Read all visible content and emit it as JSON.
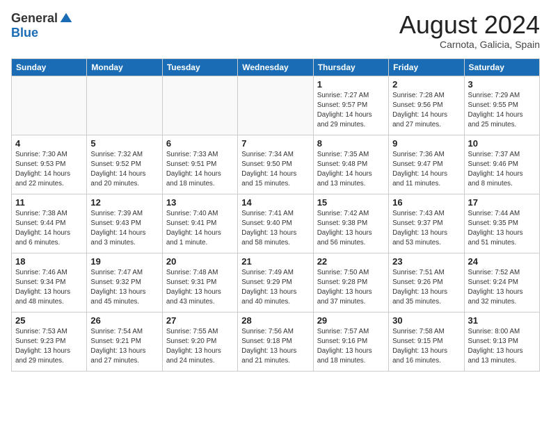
{
  "header": {
    "logo_general": "General",
    "logo_blue": "Blue",
    "month_year": "August 2024",
    "location": "Carnota, Galicia, Spain"
  },
  "days_of_week": [
    "Sunday",
    "Monday",
    "Tuesday",
    "Wednesday",
    "Thursday",
    "Friday",
    "Saturday"
  ],
  "weeks": [
    [
      {
        "day": "",
        "info": ""
      },
      {
        "day": "",
        "info": ""
      },
      {
        "day": "",
        "info": ""
      },
      {
        "day": "",
        "info": ""
      },
      {
        "day": "1",
        "info": "Sunrise: 7:27 AM\nSunset: 9:57 PM\nDaylight: 14 hours and 29 minutes."
      },
      {
        "day": "2",
        "info": "Sunrise: 7:28 AM\nSunset: 9:56 PM\nDaylight: 14 hours and 27 minutes."
      },
      {
        "day": "3",
        "info": "Sunrise: 7:29 AM\nSunset: 9:55 PM\nDaylight: 14 hours and 25 minutes."
      }
    ],
    [
      {
        "day": "4",
        "info": "Sunrise: 7:30 AM\nSunset: 9:53 PM\nDaylight: 14 hours and 22 minutes."
      },
      {
        "day": "5",
        "info": "Sunrise: 7:32 AM\nSunset: 9:52 PM\nDaylight: 14 hours and 20 minutes."
      },
      {
        "day": "6",
        "info": "Sunrise: 7:33 AM\nSunset: 9:51 PM\nDaylight: 14 hours and 18 minutes."
      },
      {
        "day": "7",
        "info": "Sunrise: 7:34 AM\nSunset: 9:50 PM\nDaylight: 14 hours and 15 minutes."
      },
      {
        "day": "8",
        "info": "Sunrise: 7:35 AM\nSunset: 9:48 PM\nDaylight: 14 hours and 13 minutes."
      },
      {
        "day": "9",
        "info": "Sunrise: 7:36 AM\nSunset: 9:47 PM\nDaylight: 14 hours and 11 minutes."
      },
      {
        "day": "10",
        "info": "Sunrise: 7:37 AM\nSunset: 9:46 PM\nDaylight: 14 hours and 8 minutes."
      }
    ],
    [
      {
        "day": "11",
        "info": "Sunrise: 7:38 AM\nSunset: 9:44 PM\nDaylight: 14 hours and 6 minutes."
      },
      {
        "day": "12",
        "info": "Sunrise: 7:39 AM\nSunset: 9:43 PM\nDaylight: 14 hours and 3 minutes."
      },
      {
        "day": "13",
        "info": "Sunrise: 7:40 AM\nSunset: 9:41 PM\nDaylight: 14 hours and 1 minute."
      },
      {
        "day": "14",
        "info": "Sunrise: 7:41 AM\nSunset: 9:40 PM\nDaylight: 13 hours and 58 minutes."
      },
      {
        "day": "15",
        "info": "Sunrise: 7:42 AM\nSunset: 9:38 PM\nDaylight: 13 hours and 56 minutes."
      },
      {
        "day": "16",
        "info": "Sunrise: 7:43 AM\nSunset: 9:37 PM\nDaylight: 13 hours and 53 minutes."
      },
      {
        "day": "17",
        "info": "Sunrise: 7:44 AM\nSunset: 9:35 PM\nDaylight: 13 hours and 51 minutes."
      }
    ],
    [
      {
        "day": "18",
        "info": "Sunrise: 7:46 AM\nSunset: 9:34 PM\nDaylight: 13 hours and 48 minutes."
      },
      {
        "day": "19",
        "info": "Sunrise: 7:47 AM\nSunset: 9:32 PM\nDaylight: 13 hours and 45 minutes."
      },
      {
        "day": "20",
        "info": "Sunrise: 7:48 AM\nSunset: 9:31 PM\nDaylight: 13 hours and 43 minutes."
      },
      {
        "day": "21",
        "info": "Sunrise: 7:49 AM\nSunset: 9:29 PM\nDaylight: 13 hours and 40 minutes."
      },
      {
        "day": "22",
        "info": "Sunrise: 7:50 AM\nSunset: 9:28 PM\nDaylight: 13 hours and 37 minutes."
      },
      {
        "day": "23",
        "info": "Sunrise: 7:51 AM\nSunset: 9:26 PM\nDaylight: 13 hours and 35 minutes."
      },
      {
        "day": "24",
        "info": "Sunrise: 7:52 AM\nSunset: 9:24 PM\nDaylight: 13 hours and 32 minutes."
      }
    ],
    [
      {
        "day": "25",
        "info": "Sunrise: 7:53 AM\nSunset: 9:23 PM\nDaylight: 13 hours and 29 minutes."
      },
      {
        "day": "26",
        "info": "Sunrise: 7:54 AM\nSunset: 9:21 PM\nDaylight: 13 hours and 27 minutes."
      },
      {
        "day": "27",
        "info": "Sunrise: 7:55 AM\nSunset: 9:20 PM\nDaylight: 13 hours and 24 minutes."
      },
      {
        "day": "28",
        "info": "Sunrise: 7:56 AM\nSunset: 9:18 PM\nDaylight: 13 hours and 21 minutes."
      },
      {
        "day": "29",
        "info": "Sunrise: 7:57 AM\nSunset: 9:16 PM\nDaylight: 13 hours and 18 minutes."
      },
      {
        "day": "30",
        "info": "Sunrise: 7:58 AM\nSunset: 9:15 PM\nDaylight: 13 hours and 16 minutes."
      },
      {
        "day": "31",
        "info": "Sunrise: 8:00 AM\nSunset: 9:13 PM\nDaylight: 13 hours and 13 minutes."
      }
    ]
  ]
}
